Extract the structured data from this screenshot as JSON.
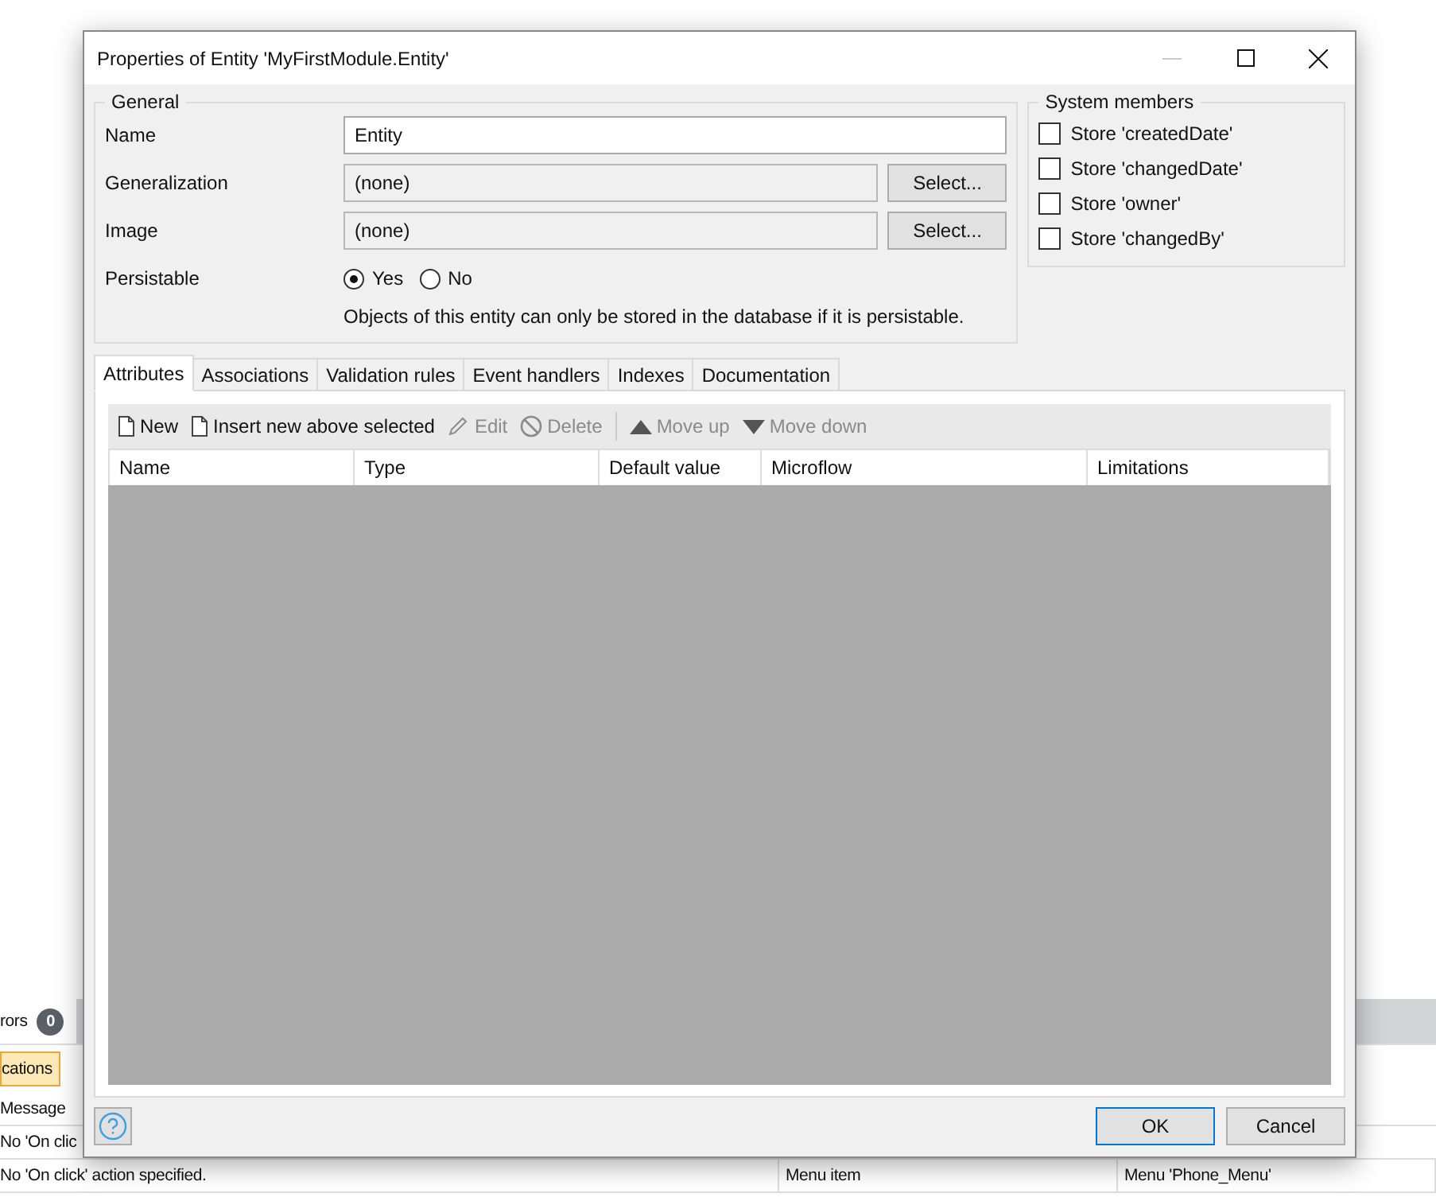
{
  "background_panel": {
    "tabs": [
      {
        "label": "rors",
        "count": "0"
      }
    ],
    "filter_tabs": [
      {
        "label": "cations",
        "selected": true
      }
    ],
    "columns": [
      "Message"
    ],
    "rows": [
      [
        "No 'On clic"
      ],
      [
        "No 'On click' action specified.",
        "Menu item",
        "Menu 'Phone_Menu'"
      ]
    ]
  },
  "window": {
    "title": "Properties of Entity 'MyFirstModule.Entity'"
  },
  "general": {
    "title": "General",
    "fields": [
      {
        "label": "Name",
        "kind": "text",
        "value": "Entity"
      },
      {
        "label": "Generalization",
        "kind": "select",
        "value": "(none)",
        "button": "Select..."
      },
      {
        "label": "Image",
        "kind": "select",
        "value": "(none)",
        "button": "Select..."
      }
    ],
    "persistable": {
      "label": "Persistable",
      "options": [
        {
          "label": "Yes",
          "selected": true
        },
        {
          "label": "No",
          "selected": false
        }
      ],
      "note": "Objects of this entity can only be stored in the database if it is persistable."
    }
  },
  "system_members": {
    "title": "System members",
    "items": [
      {
        "label": "Store 'createdDate'",
        "checked": false
      },
      {
        "label": "Store 'changedDate'",
        "checked": false
      },
      {
        "label": "Store 'owner'",
        "checked": false
      },
      {
        "label": "Store 'changedBy'",
        "checked": false
      }
    ]
  },
  "tabs": [
    {
      "label": "Attributes",
      "selected": true
    },
    {
      "label": "Associations",
      "selected": false
    },
    {
      "label": "Validation rules",
      "selected": false
    },
    {
      "label": "Event handlers",
      "selected": false
    },
    {
      "label": "Indexes",
      "selected": false
    },
    {
      "label": "Documentation",
      "selected": false
    }
  ],
  "toolbar": [
    {
      "label": "New",
      "kind": "document",
      "disabled": false
    },
    {
      "label": "Insert new above selected",
      "kind": "document",
      "disabled": false
    },
    {
      "label": "Edit",
      "kind": "pencil",
      "disabled": true
    },
    {
      "label": "Delete",
      "kind": "forbidden",
      "disabled": true
    },
    {
      "kind": "separator"
    },
    {
      "label": "Move up",
      "kind": "up",
      "disabled": true
    },
    {
      "label": "Move down",
      "kind": "down",
      "disabled": true
    }
  ],
  "table": {
    "columns": [
      "Name",
      "Type",
      "Default value",
      "Microflow",
      "Limitations"
    ]
  },
  "buttons": [
    {
      "label": "OK",
      "default": true
    },
    {
      "label": "Cancel",
      "default": false
    }
  ]
}
